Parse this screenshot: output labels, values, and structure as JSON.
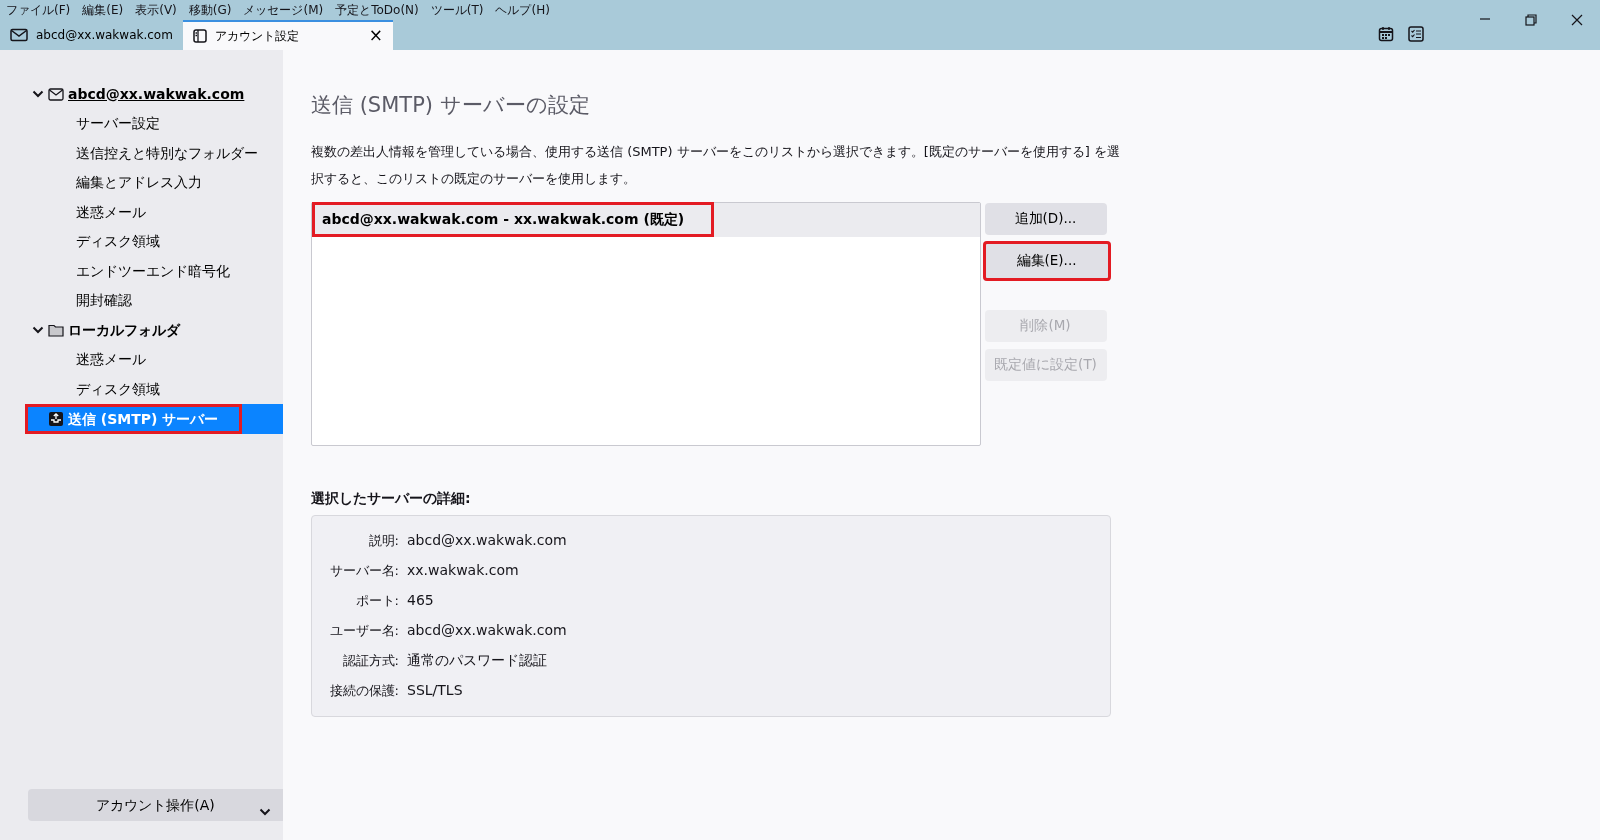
{
  "menu_bar": [
    "ファイル(F)",
    "編集(E)",
    "表示(V)",
    "移動(G)",
    "メッセージ(M)",
    "予定とToDo(N)",
    "ツール(T)",
    "ヘルプ(H)"
  ],
  "tabs": [
    {
      "label": "abcd@xx.wakwak.com",
      "kind": "mail",
      "selected": false
    },
    {
      "label": "アカウント設定",
      "kind": "settings",
      "selected": true,
      "close": "×"
    }
  ],
  "sidebar": {
    "items": [
      {
        "label": "abcd@xx.wakwak.com",
        "kind": "account",
        "expanded": true,
        "selected": false,
        "annotated": false,
        "children": [
          {
            "label": "サーバー設定",
            "selected": false
          },
          {
            "label": "送信控えと特別なフォルダー",
            "selected": false
          },
          {
            "label": "編集とアドレス入力",
            "selected": false
          },
          {
            "label": "迷惑メール",
            "selected": false
          },
          {
            "label": "ディスク領域",
            "selected": false
          },
          {
            "label": "エンドツーエンド暗号化",
            "selected": false
          },
          {
            "label": "開封確認",
            "selected": false
          }
        ]
      },
      {
        "label": "ローカルフォルダ",
        "kind": "folder",
        "expanded": true,
        "selected": false,
        "annotated": false,
        "children": [
          {
            "label": "迷惑メール",
            "selected": false
          },
          {
            "label": "ディスク領域",
            "selected": false
          }
        ]
      },
      {
        "label": "送信 (SMTP) サーバー",
        "kind": "smtp",
        "selected": true,
        "annotated": true
      }
    ],
    "account_actions": "アカウント操作(A)"
  },
  "page": {
    "title": "送信 (SMTP) サーバーの設定",
    "description": "複数の差出人情報を管理している場合、使用する送信 (SMTP) サーバーをこのリストから選択できます。[既定のサーバーを使用する] を選択すると、このリストの既定のサーバーを使用します。",
    "servers": [
      {
        "label": "abcd@xx.wakwak.com - xx.wakwak.com (既定)",
        "selected": true,
        "annotated": true
      }
    ],
    "buttons": [
      {
        "label": "追加(D)...",
        "disabled": false,
        "annotated": false
      },
      {
        "label": "編集(E)...",
        "disabled": false,
        "annotated": true
      },
      {
        "label": "削除(M)",
        "disabled": true,
        "annotated": false
      },
      {
        "label": "既定値に設定(T)",
        "disabled": true,
        "annotated": false
      }
    ],
    "details_title": "選択したサーバーの詳細:",
    "details": [
      {
        "label": "説明:",
        "value": "abcd@xx.wakwak.com"
      },
      {
        "label": "サーバー名:",
        "value": "xx.wakwak.com"
      },
      {
        "label": "ポート:",
        "value": "465"
      },
      {
        "label": "ユーザー名:",
        "value": "abcd@xx.wakwak.com"
      },
      {
        "label": "認証方式:",
        "value": "通常のパスワード認証"
      },
      {
        "label": "接続の保護:",
        "value": "SSL/TLS"
      }
    ]
  }
}
